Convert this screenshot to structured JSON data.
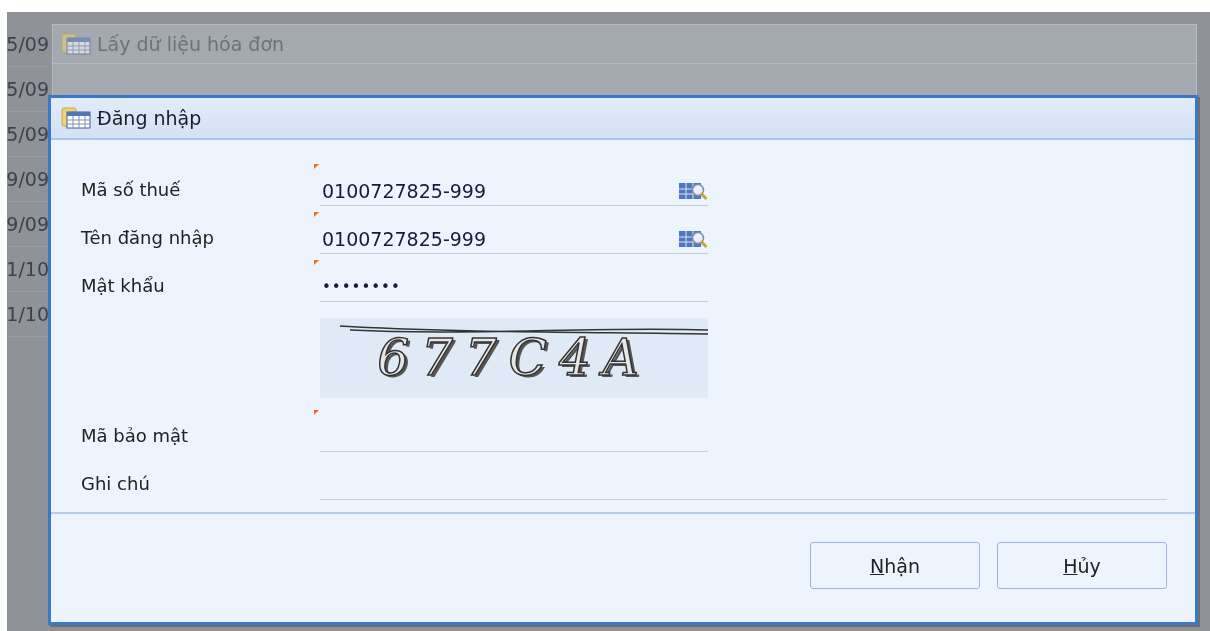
{
  "background_rows": [
    "5/09",
    "5/09",
    "5/09",
    "9/09",
    "9/09",
    "1/10",
    "1/10"
  ],
  "parent_window": {
    "title": "Lấy dữ liệu hóa đơn"
  },
  "dialog": {
    "title": "Đăng nhập",
    "fields": [
      {
        "kind": "text",
        "label": "Mã số thuế",
        "value": "0100727825-999",
        "required": true,
        "lookup": true
      },
      {
        "kind": "text",
        "label": "Tên đăng nhập",
        "value": "0100727825-999",
        "required": true,
        "lookup": true
      },
      {
        "kind": "password",
        "label": "Mật khẩu",
        "value": "••••••••",
        "required": true,
        "lookup": false
      },
      {
        "kind": "captcha",
        "text": "677C4A"
      },
      {
        "kind": "text",
        "label": "Mã bảo mật",
        "required": true,
        "lookup": false
      },
      {
        "kind": "wide",
        "label": "Ghi chú",
        "required": false,
        "lookup": false
      }
    ],
    "buttons": [
      {
        "label": "Nhận",
        "underline_first": true
      },
      {
        "label": "Hủy",
        "underline_first": true
      }
    ]
  }
}
